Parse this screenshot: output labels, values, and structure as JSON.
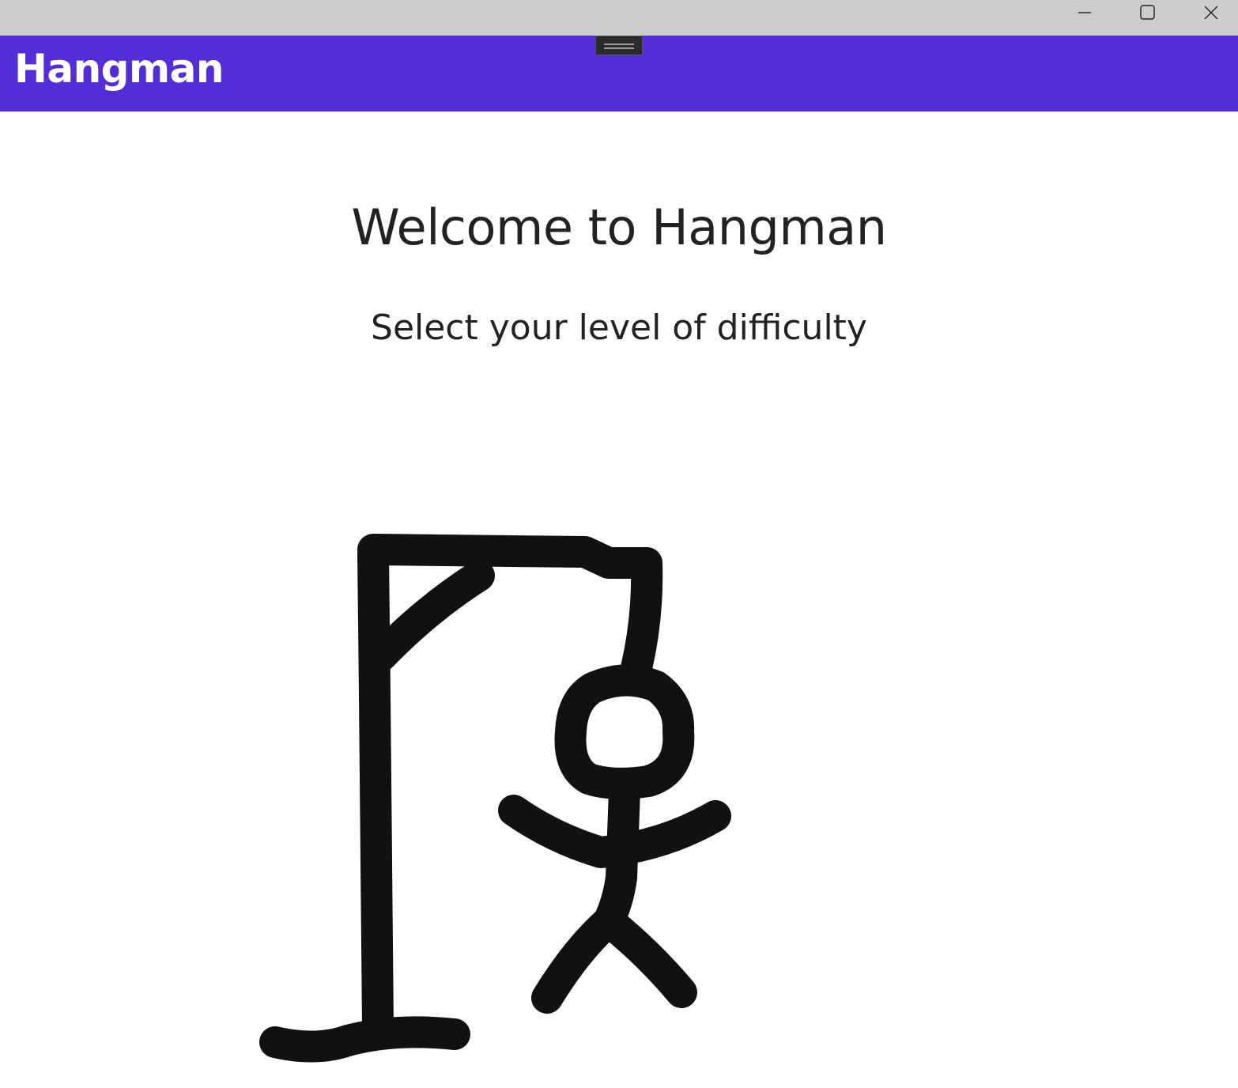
{
  "window": {
    "controls": [
      "minimize-icon",
      "maximize-icon",
      "close-icon"
    ]
  },
  "appbar": {
    "title": "Hangman",
    "color": "#532ed6"
  },
  "main": {
    "heading": "Welcome to Hangman",
    "subheading": "Select your level of difficulty"
  },
  "illustration": {
    "icon": "hangman-drawing"
  }
}
